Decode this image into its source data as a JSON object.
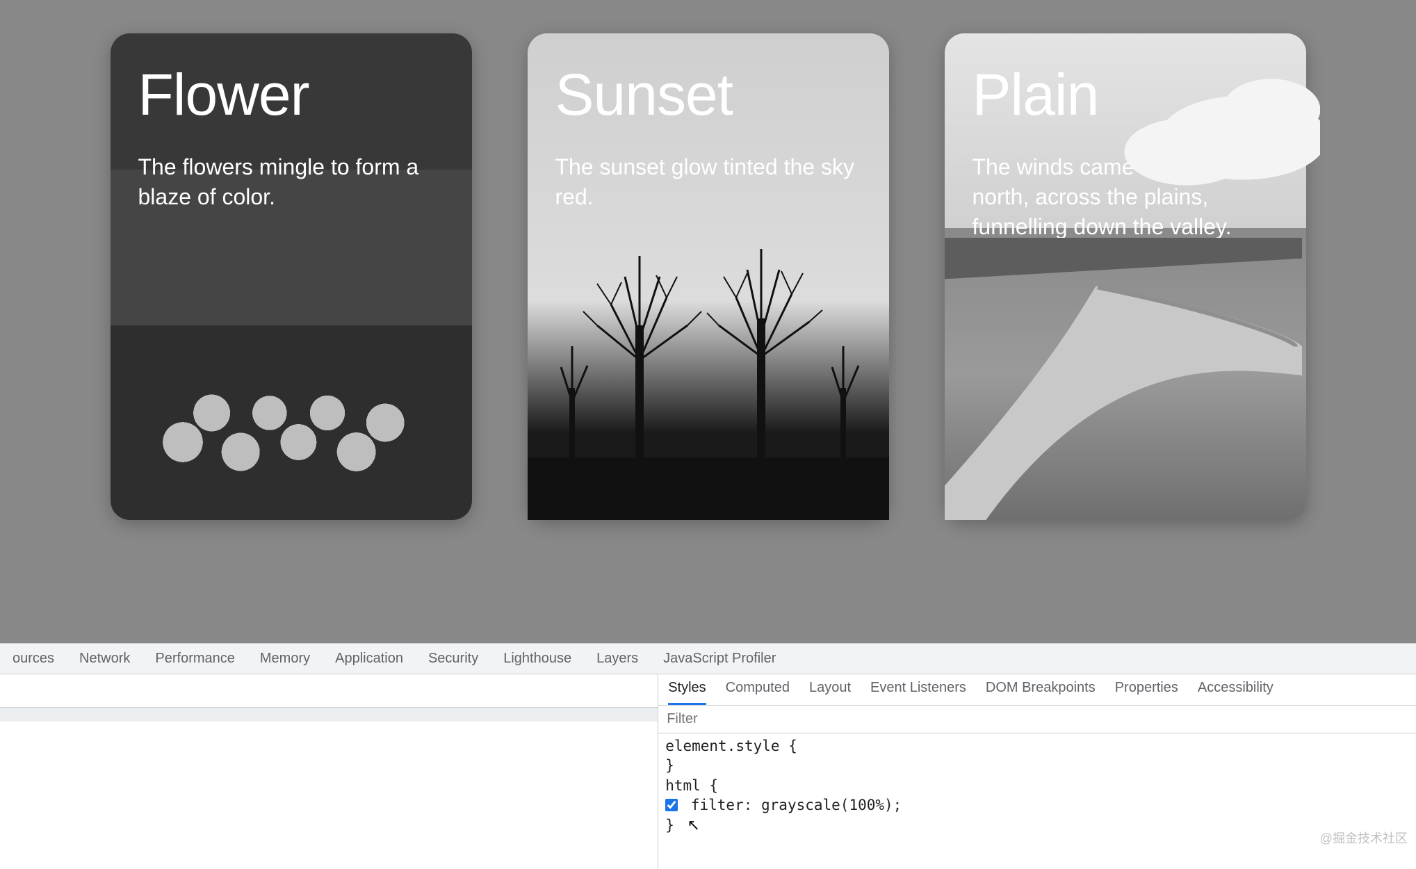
{
  "cards": [
    {
      "title": "Flower",
      "desc": "The flowers mingle to form a blaze of color."
    },
    {
      "title": "Sunset",
      "desc": "The sunset glow tinted the sky red."
    },
    {
      "title": "Plain",
      "desc": "The winds came from the north, across the plains, funnelling down the valley."
    }
  ],
  "devtools": {
    "top_tabs": {
      "sources": "ources",
      "network": "Network",
      "performance": "Performance",
      "memory": "Memory",
      "application": "Application",
      "security": "Security",
      "lighthouse": "Lighthouse",
      "layers": "Layers",
      "jsprofiler": "JavaScript Profiler"
    },
    "sub_tabs": {
      "styles": "Styles",
      "computed": "Computed",
      "layout": "Layout",
      "event_listeners": "Event Listeners",
      "dom_breakpoints": "DOM Breakpoints",
      "properties": "Properties",
      "accessibility": "Accessibility"
    },
    "filter_placeholder": "Filter",
    "rules": {
      "r0_selector": "element.style",
      "r0_open": " {",
      "r0_close": "}",
      "r1_selector": "html",
      "r1_open": " {",
      "r1_prop": "filter",
      "r1_colon": ": ",
      "r1_value": "grayscale(100%)",
      "r1_semicolon": ";",
      "r1_close": "}",
      "checked": true
    }
  },
  "watermark": "@掘金技术社区"
}
